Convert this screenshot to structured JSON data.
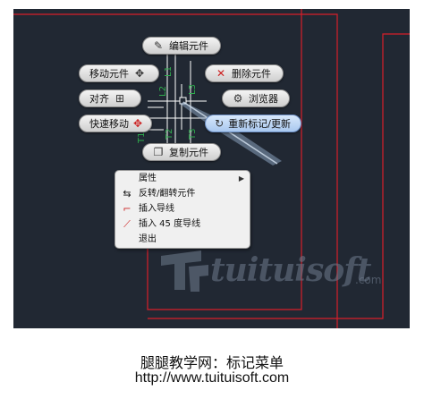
{
  "marking_menu": {
    "items": [
      {
        "label": "编辑元件",
        "icon": "edit-component-icon"
      },
      {
        "label": "移动元件",
        "icon": "move-component-icon"
      },
      {
        "label": "删除元件",
        "icon": "delete-component-icon"
      },
      {
        "label": "对齐",
        "icon": "align-icon"
      },
      {
        "label": "浏览器",
        "icon": "browser-icon"
      },
      {
        "label": "快速移动",
        "icon": "quick-move-icon"
      },
      {
        "label": "重新标记/更新",
        "icon": "retag-update-icon"
      },
      {
        "label": "复制元件",
        "icon": "copy-component-icon"
      }
    ]
  },
  "wire_labels": {
    "l1": "L1",
    "l2": "L2",
    "l3": "L3",
    "t1": "T1",
    "t2": "T2",
    "t3": "T3"
  },
  "context_menu": {
    "items": [
      {
        "label": "属性",
        "icon": "",
        "submenu": true
      },
      {
        "label": "反转/翻转元件",
        "icon": "flip-component-icon"
      },
      {
        "label": "插入导线",
        "icon": "insert-wire-icon"
      },
      {
        "label": "插入 45 度导线",
        "icon": "insert-45-wire-icon"
      },
      {
        "label": "退出",
        "icon": ""
      }
    ]
  },
  "watermark": {
    "text": "tuituisoft",
    "suffix": ".com"
  },
  "caption": {
    "title": "腿腿教学网：标记菜单",
    "url": "http://www.tuituisoft.com"
  },
  "colors": {
    "canvas": "#212833",
    "frame": "#d81e2a",
    "wire": "#ffffff",
    "wire_label": "#2fae4e",
    "active_item": "#a9c8ef"
  }
}
